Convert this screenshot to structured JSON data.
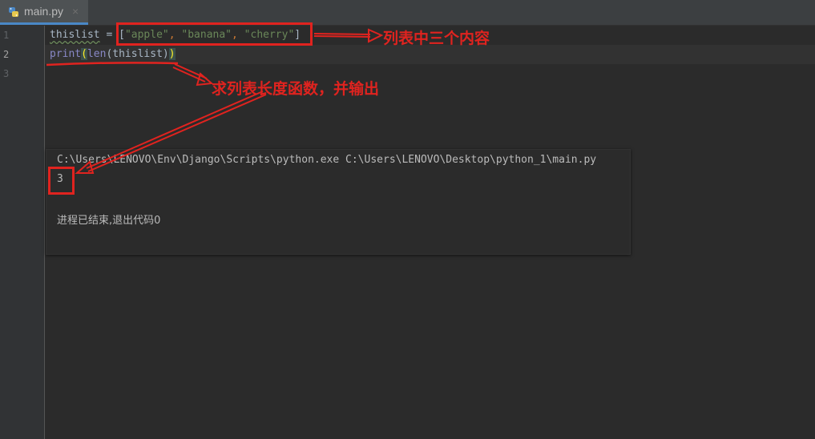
{
  "tab": {
    "filename": "main.py",
    "close_glyph": "×",
    "icon": "python-file-icon"
  },
  "gutter": {
    "line_numbers": [
      "1",
      "2",
      "3"
    ],
    "active_line": "2"
  },
  "code": {
    "line1": {
      "var": "thislist",
      "assign": " = ",
      "open": "[",
      "items": [
        "\"apple\"",
        "\"banana\"",
        "\"cherry\""
      ],
      "sep": ", ",
      "close": "]"
    },
    "line2": {
      "print": "print",
      "paren_open": "(",
      "len": "len",
      "inner_open": "(",
      "arg": "thislist",
      "inner_close": ")",
      "paren_close": ")"
    }
  },
  "console": {
    "command": "C:\\Users\\LENOVO\\Env\\Django\\Scripts\\python.exe C:\\Users\\LENOVO\\Desktop\\python_1\\main.py",
    "output": "3",
    "exit_message": "进程已结束,退出代码0"
  },
  "annotations": {
    "list_contents": "列表中三个内容",
    "len_function": "求列表长度函数，并输出"
  },
  "colors": {
    "annotation_red": "#e0231f",
    "editor_bg": "#2b2b2b",
    "string_green": "#6a8759",
    "builtin_purple": "#8888c6"
  }
}
